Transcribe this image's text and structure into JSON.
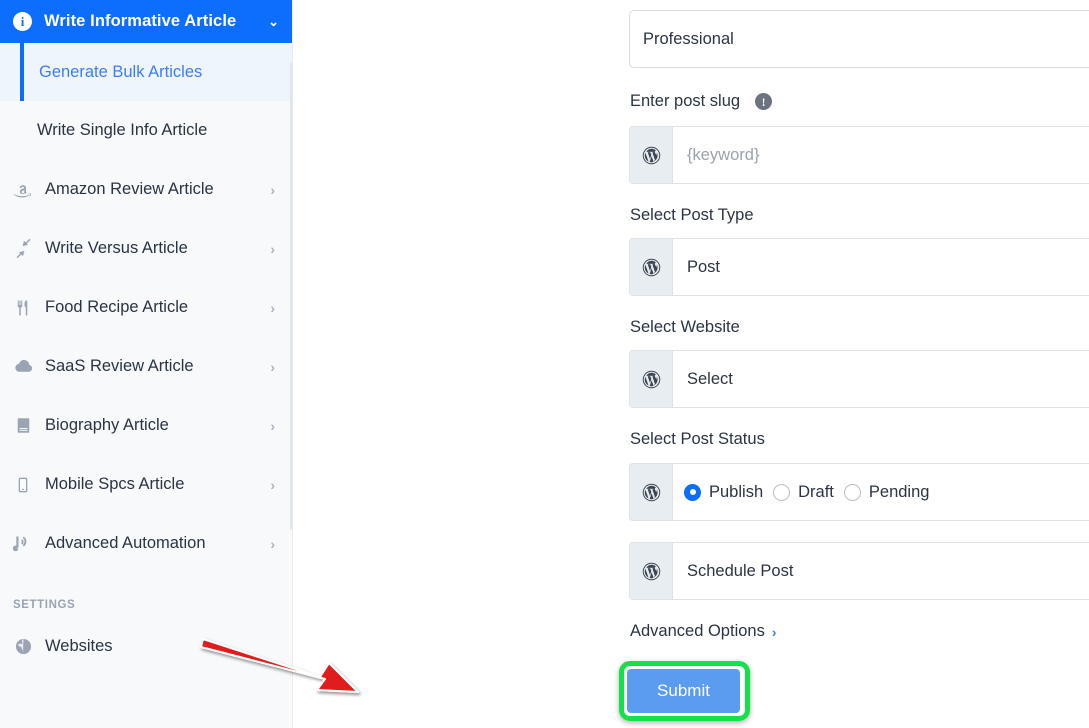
{
  "sidebar": {
    "header": {
      "icon": "info-circle-icon",
      "title": "Write Informative Article",
      "caret": "⌄"
    },
    "subitems": [
      {
        "label": "Generate Bulk Articles",
        "active": true
      },
      {
        "label": "Write Single Info Article",
        "active": false
      }
    ],
    "items": [
      {
        "label": "Amazon Review Article",
        "icon": "amazon-icon",
        "chevron": "›"
      },
      {
        "label": "Write Versus Article",
        "icon": "compress-arrows-icon",
        "chevron": "›"
      },
      {
        "label": "Food Recipe Article",
        "icon": "utensils-icon",
        "chevron": "›"
      },
      {
        "label": "SaaS Review Article",
        "icon": "cloud-icon",
        "chevron": "›"
      },
      {
        "label": "Biography Article",
        "icon": "book-icon",
        "chevron": "›"
      },
      {
        "label": "Mobile Spcs Article",
        "icon": "mobile-icon",
        "chevron": "›"
      },
      {
        "label": "Advanced Automation",
        "icon": "broadcast-tower-icon",
        "chevron": "›"
      }
    ],
    "section_label": "SETTINGS",
    "settings_items": [
      {
        "label": "Websites",
        "icon": "globe-icon"
      }
    ]
  },
  "form": {
    "tone_value": "Professional",
    "slug": {
      "label": "Enter post slug",
      "help_icon": "info-icon",
      "help_glyph": "!",
      "addon_icon": "wordpress-icon",
      "placeholder": "{keyword}"
    },
    "post_type": {
      "label": "Select Post Type",
      "addon_icon": "wordpress-icon",
      "value": "Post"
    },
    "website": {
      "label": "Select Website",
      "addon_icon": "wordpress-icon",
      "value": "Select"
    },
    "post_status": {
      "label": "Select Post Status",
      "addon_icon": "wordpress-icon",
      "options": [
        {
          "label": "Publish",
          "selected": true
        },
        {
          "label": "Draft",
          "selected": false
        },
        {
          "label": "Pending",
          "selected": false
        }
      ]
    },
    "schedule": {
      "addon_icon": "wordpress-icon",
      "value": "Schedule Post"
    },
    "advanced_options": {
      "label": "Advanced Options",
      "chevron": "›"
    },
    "submit_label": "Submit"
  },
  "annotation": {
    "arrow_color": "#e01b1b",
    "highlight_color": "#14e04a",
    "target": "submit-button"
  },
  "colors": {
    "accent_blue": "#0d6efd",
    "sidebar_bg": "#f7f9fb",
    "active_item_bg": "#eff5fd",
    "button_blue": "#5b9bf0",
    "highlight_green": "#14e04a",
    "arrow_red": "#e01b1b"
  }
}
